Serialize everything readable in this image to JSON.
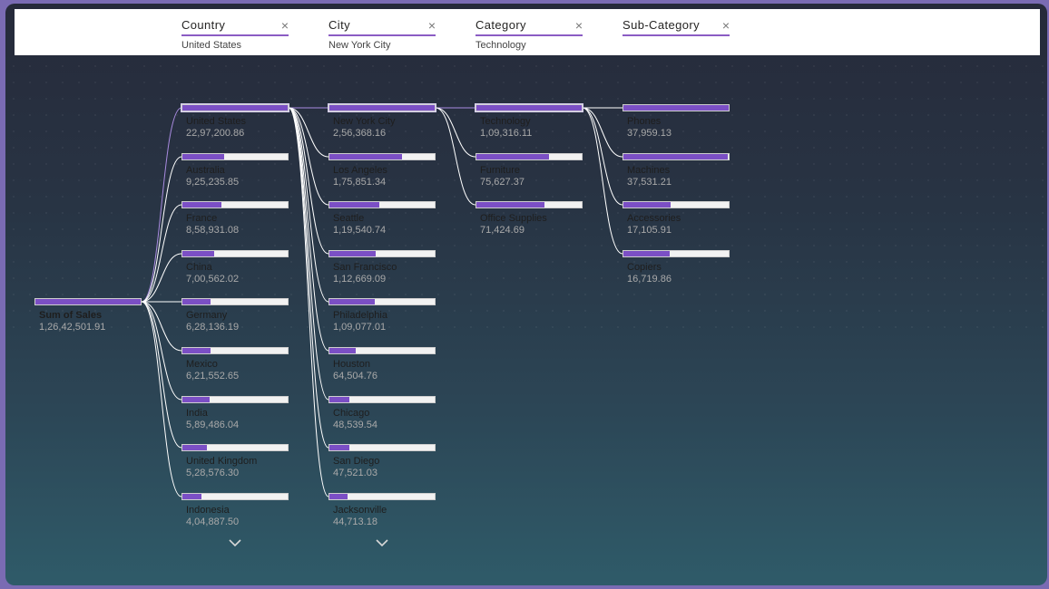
{
  "header": [
    {
      "title": "Country",
      "value": "United States"
    },
    {
      "title": "City",
      "value": "New York City"
    },
    {
      "title": "Category",
      "value": "Technology"
    },
    {
      "title": "Sub-Category",
      "value": ""
    }
  ],
  "close_glyph": "×",
  "colors": {
    "accent": "#7b4fc5",
    "bar_bg": "#f2f2f2"
  },
  "root": {
    "label": "Sum of Sales",
    "value": "1,26,42,501.91",
    "fraction": 1.0
  },
  "levels": [
    {
      "name": "Country",
      "expandable": true,
      "nodes": [
        {
          "label": "United States",
          "value": "22,97,200.86",
          "fraction": 1.0,
          "selected": true
        },
        {
          "label": "Australia",
          "value": "9,25,235.85",
          "fraction": 0.4
        },
        {
          "label": "France",
          "value": "8,58,931.08",
          "fraction": 0.37
        },
        {
          "label": "China",
          "value": "7,00,562.02",
          "fraction": 0.3
        },
        {
          "label": "Germany",
          "value": "6,28,136.19",
          "fraction": 0.27
        },
        {
          "label": "Mexico",
          "value": "6,21,552.65",
          "fraction": 0.27
        },
        {
          "label": "India",
          "value": "5,89,486.04",
          "fraction": 0.26
        },
        {
          "label": "United Kingdom",
          "value": "5,28,576.30",
          "fraction": 0.23
        },
        {
          "label": "Indonesia",
          "value": "4,04,887.50",
          "fraction": 0.18
        }
      ]
    },
    {
      "name": "City",
      "expandable": true,
      "nodes": [
        {
          "label": "New York City",
          "value": "2,56,368.16",
          "fraction": 1.0,
          "selected": true
        },
        {
          "label": "Los Angeles",
          "value": "1,75,851.34",
          "fraction": 0.69
        },
        {
          "label": "Seattle",
          "value": "1,19,540.74",
          "fraction": 0.47
        },
        {
          "label": "San Francisco",
          "value": "1,12,669.09",
          "fraction": 0.44
        },
        {
          "label": "Philadelphia",
          "value": "1,09,077.01",
          "fraction": 0.43
        },
        {
          "label": "Houston",
          "value": "64,504.76",
          "fraction": 0.25
        },
        {
          "label": "Chicago",
          "value": "48,539.54",
          "fraction": 0.19
        },
        {
          "label": "San Diego",
          "value": "47,521.03",
          "fraction": 0.19
        },
        {
          "label": "Jacksonville",
          "value": "44,713.18",
          "fraction": 0.17
        }
      ]
    },
    {
      "name": "Category",
      "expandable": false,
      "nodes": [
        {
          "label": "Technology",
          "value": "1,09,316.11",
          "fraction": 1.0,
          "selected": true
        },
        {
          "label": "Furniture",
          "value": "75,627.37",
          "fraction": 0.69
        },
        {
          "label": "Office Supplies",
          "value": "71,424.69",
          "fraction": 0.65
        }
      ]
    },
    {
      "name": "Sub-Category",
      "expandable": false,
      "nodes": [
        {
          "label": "Phones",
          "value": "37,959.13",
          "fraction": 1.0
        },
        {
          "label": "Machines",
          "value": "37,531.21",
          "fraction": 0.99
        },
        {
          "label": "Accessories",
          "value": "17,105.91",
          "fraction": 0.45
        },
        {
          "label": "Copiers",
          "value": "16,719.86",
          "fraction": 0.44
        }
      ]
    }
  ]
}
